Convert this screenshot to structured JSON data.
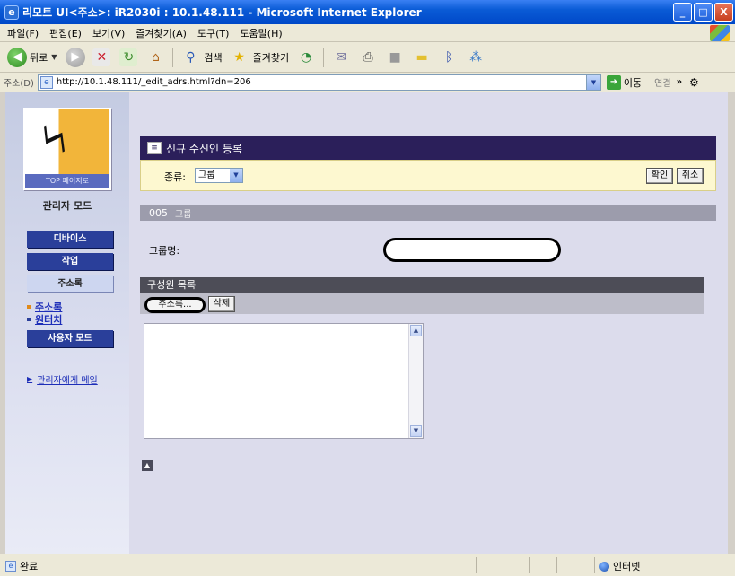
{
  "window": {
    "title": "리모트 UI<주소>: iR2030i : 10.1.48.111 - Microsoft Internet Explorer",
    "controls": [
      "_",
      "□",
      "X"
    ]
  },
  "menubar": {
    "items": [
      "파일(F)",
      "편집(E)",
      "보기(V)",
      "즐겨찾기(A)",
      "도구(T)",
      "도움말(H)"
    ]
  },
  "toolbar": {
    "back_label": "뒤로",
    "search_label": "검색",
    "favorites_label": "즐겨찾기"
  },
  "addressbar": {
    "label": "주소(D)",
    "url": "http://10.1.48.111/_edit_adrs.html?dn=206",
    "go_label": "이동",
    "links_label": "연결"
  },
  "sidebar": {
    "logo_caption": "TOP 페이지로",
    "mode_title": "관리자 모드",
    "nav": {
      "device": "디바이스",
      "job": "작업",
      "address_book": "주소록",
      "address_book_link": "주소록",
      "one_touch_link": "원터치",
      "user_mode": "사용자 모드"
    },
    "mail_admin_link": "관리자에게 메일",
    "colors": {
      "nav_bg": "#2a3f9a",
      "link": "#1d2eb8"
    }
  },
  "main": {
    "panel_title": "신규 수신인 등록",
    "type_label": "종류:",
    "type_value": "그룹",
    "ok_label": "확인",
    "cancel_label": "취소",
    "entry_number": "005",
    "entry_kind": "그룹",
    "group_name_label": "그룹명:",
    "group_name_value": "",
    "members_title": "구성원 목록",
    "address_book_button": "주소록...",
    "delete_button": "삭제",
    "back_to_top_icon": "back-to-top-icon"
  },
  "statusbar": {
    "status_text": "완료",
    "zone_text": "인터넷"
  }
}
